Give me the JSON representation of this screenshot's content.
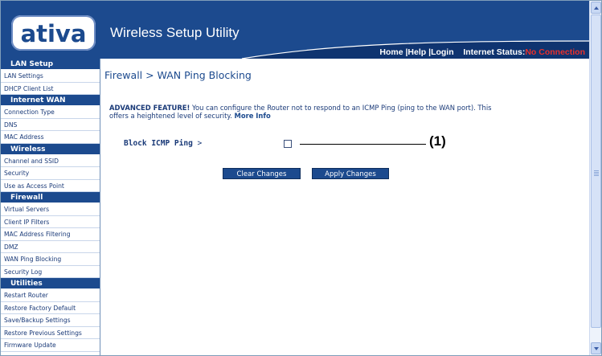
{
  "app": {
    "logo": "ativa",
    "logo_mark": "™",
    "title": "Wireless Setup Utility"
  },
  "topnav": {
    "home": "Home",
    "help": "Help",
    "login": "Login",
    "sep": "|",
    "status_label": "Internet Status:",
    "status_value": "No Connection"
  },
  "sidebar": {
    "sections": [
      {
        "title": "LAN Setup",
        "items": [
          "LAN Settings",
          "DHCP Client List"
        ]
      },
      {
        "title": "Internet WAN",
        "items": [
          "Connection Type",
          "DNS",
          "MAC Address"
        ]
      },
      {
        "title": "Wireless",
        "items": [
          "Channel and SSID",
          "Security",
          "Use as Access Point"
        ]
      },
      {
        "title": "Firewall",
        "items": [
          "Virtual Servers",
          "Client IP Filters",
          "MAC Address Filtering",
          "DMZ",
          "WAN Ping Blocking",
          "Security Log"
        ]
      },
      {
        "title": "Utilities",
        "items": [
          "Restart Router",
          "Restore Factory Default",
          "Save/Backup Settings",
          "Restore Previous Settings",
          "Firmware Update"
        ]
      }
    ]
  },
  "main": {
    "page_title": "Firewall > WAN Ping Blocking",
    "desc_bold": "ADVANCED FEATURE!",
    "desc_text": " You can configure the Router not to respond to an ICMP Ping (ping to the WAN port). This offers a heightened level of security. ",
    "more_info": "More Info",
    "field_label": "Block ICMP Ping",
    "field_suffix": " >",
    "checkbox_checked": false,
    "callout": "(1)",
    "clear_button": "Clear Changes",
    "apply_button": "Apply Changes"
  },
  "colors": {
    "brand_blue": "#1c4a8e",
    "status_red": "#e8302c"
  },
  "icons": {
    "scroll_up": "chevron-up-icon",
    "scroll_down": "chevron-down-icon"
  }
}
